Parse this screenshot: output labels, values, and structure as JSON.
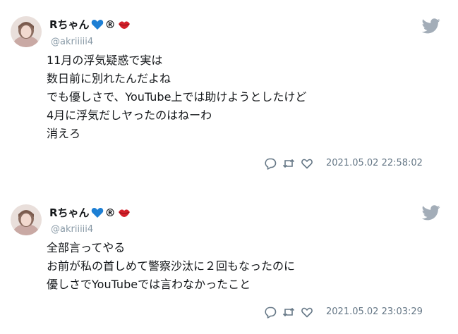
{
  "tweets": [
    {
      "display_name": "Rちゃん",
      "name_suffix": "®",
      "handle": "@akriiiii4",
      "lines": [
        "11月の浮気疑惑で実は",
        "数日前に別れたんだよね",
        "でも優しさで、YouTube上では助けようとしたけど",
        "4月に浮気だしヤったのはねーわ",
        "消えろ"
      ],
      "timestamp": "2021.05.02 22:58:02"
    },
    {
      "display_name": "Rちゃん",
      "name_suffix": "®",
      "handle": "@akriiiii4",
      "lines": [
        "全部言ってやる",
        "お前が私の首しめて警察沙汰に２回もなったのに",
        "優しさでYouTubeでは言わなかったこと"
      ],
      "timestamp": "2021.05.02 23:03:29"
    }
  ],
  "icons": {
    "heart": "blue-heart-icon",
    "lips": "lips-icon",
    "brand": "twitter-bird-icon",
    "reply": "reply-icon",
    "retweet": "retweet-icon",
    "like": "like-icon"
  },
  "colors": {
    "name": "#14171a",
    "handle": "#8899a6",
    "timestamp": "#657786",
    "bird": "#a3adb8",
    "heart": "#1d7fd4",
    "lips": "#d4202a"
  }
}
